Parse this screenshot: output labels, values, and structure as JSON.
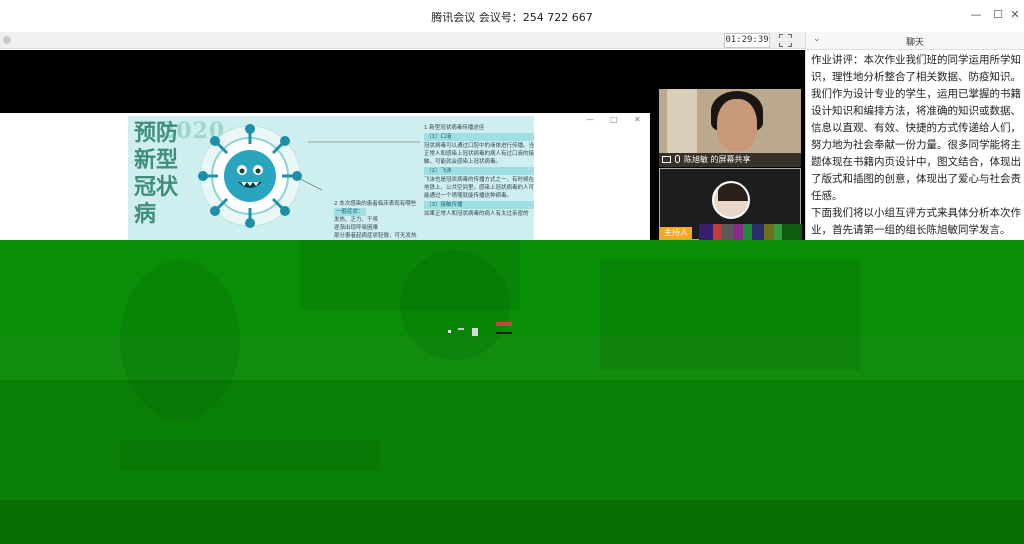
{
  "titlebar": {
    "title": "腾讯会议  会议号：254 722 667",
    "minimize_icon": "minimize-icon",
    "maximize_icon": "maximize-icon",
    "close_icon": "close-icon"
  },
  "video_toolbar": {
    "timer": "01:29:39",
    "fullscreen_icon": "fullscreen-icon"
  },
  "shared_slide": {
    "title_vertical": "预防新型冠状病",
    "year": "2020",
    "section1_title": "1 新型冠状病毒传播途径",
    "route1_label": "（1）口液",
    "route1_text": "冠状病毒可以通过口腔中的液体进行传播。当正常人和感染上冠状病毒的病人有过口液的接触，可能就会感染上冠状病毒。",
    "route2_label": "（2）飞沫",
    "route2_text": "飞沫也是冠状病毒的传播方式之一，有时候在地铁上、公共空间里，感染上冠状病毒的人可能通过一个喷嚏就能传播这种病毒。",
    "route3_label": "（3）接触传播",
    "route3_text": "如果正常人和冠状病毒的病人有太过亲密的",
    "section2_title": "2 本次感染的患者临床表现有哪些",
    "symptom_label": "一般症状：",
    "symptom_text1": "发热、乏力、干咳",
    "symptom_text2": "逐渐出现呼吸困难",
    "symptom_text3": "部分患者起病症状轻微，可无发热"
  },
  "participants": [
    {
      "name": "陈旭敏 的屏幕共享",
      "screen_icon": "screen-share-icon",
      "mic_icon": "microphone-icon"
    },
    {
      "badge": "主持人"
    }
  ],
  "chat": {
    "title": "聊天",
    "collapse_icon": "chevron-down-icon",
    "messages": [
      "作业讲评：本次作业我们班的同学运用所学知识，理性地分析整合了相关数据、防疫知识。我们作为设计专业的学生，运用已掌握的书籍设计知识和编排方法，将准确的知识或数据、信息以直观、有效、快捷的方式传递给人们，努力地为社会奉献一份力量。很多同学能将主题体现在书籍内页设计中，图文结合，体现出了版式和插图的创意，体现出了爱心与社会责任感。",
      "下面我们将以小组互评方式来具体分析本次作业，首先请第一组的组长陈旭敏同学发言。"
    ]
  },
  "colors": {
    "corruption_green": "#0b8a08",
    "slide_bg": "#cfeef0",
    "host_badge": "#f6a81e"
  }
}
